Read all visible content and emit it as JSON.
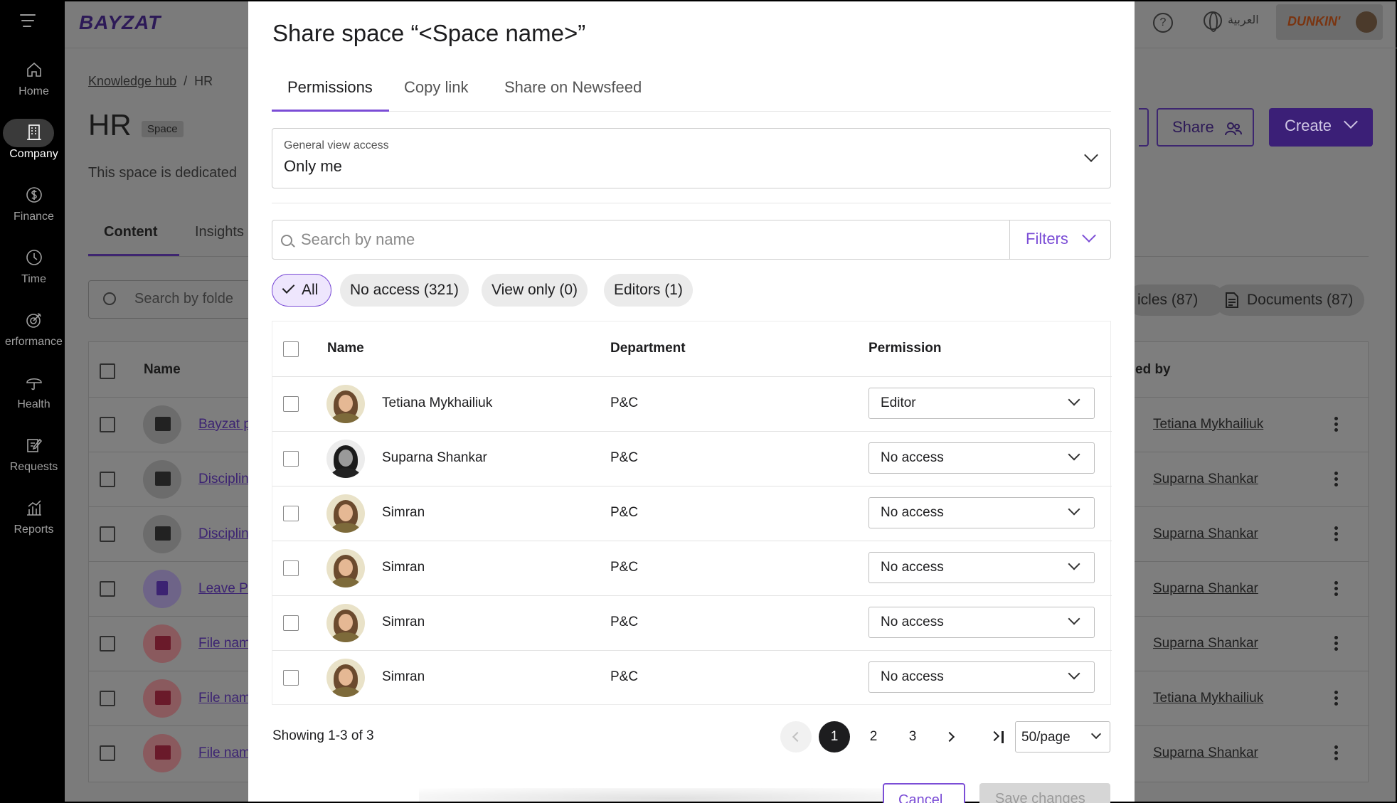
{
  "sidebar": {
    "items": [
      {
        "label": "Home",
        "icon": "home-icon"
      },
      {
        "label": "Company",
        "icon": "building-icon",
        "active": true
      },
      {
        "label": "Finance",
        "icon": "dollar-icon"
      },
      {
        "label": "Time",
        "icon": "clock-icon"
      },
      {
        "label": "erformance",
        "icon": "target-icon"
      },
      {
        "label": "Health",
        "icon": "umbrella-icon"
      },
      {
        "label": "Requests",
        "icon": "edit-icon"
      },
      {
        "label": "Reports",
        "icon": "chart-icon"
      }
    ]
  },
  "topbar": {
    "logo": "BAYZAT",
    "help": "?",
    "language": "العربية",
    "company_brand": "DUNKIN'"
  },
  "page": {
    "breadcrumb": {
      "root": "Knowledge hub",
      "sep": "/",
      "current": "HR"
    },
    "title": "HR",
    "tag": "Space",
    "description": "This space is dedicated",
    "tabs": [
      "Content",
      "Insights"
    ],
    "folder_search_placeholder": "Search by folde",
    "share_label": "Share",
    "create_label": "Create",
    "chips": [
      "icles (87)",
      "Documents (87)"
    ],
    "table_header_name": "Name",
    "table_header_owner": "ed by",
    "rows": [
      {
        "name": "Bayzat p",
        "owner": "Tetiana Mykhailiuk",
        "kind": "folder"
      },
      {
        "name": "Disciplin",
        "owner": "Suparna Shankar",
        "kind": "folder"
      },
      {
        "name": "Disciplin",
        "owner": "Suparna Shankar",
        "kind": "folder"
      },
      {
        "name": "Leave P",
        "owner": "Suparna Shankar",
        "kind": "doc"
      },
      {
        "name": "File nam",
        "owner": "Suparna Shankar",
        "kind": "pdf"
      },
      {
        "name": "File nam",
        "owner": "Tetiana Mykhailiuk",
        "kind": "pdf"
      },
      {
        "name": "File nam",
        "owner": "Suparna Shankar",
        "kind": "pdf"
      }
    ]
  },
  "modal": {
    "title": "Share space “<Space name>”",
    "tabs": [
      "Permissions",
      "Copy link",
      "Share on Newsfeed"
    ],
    "general_access": {
      "label": "General view access",
      "value": "Only me"
    },
    "search_placeholder": "Search by name",
    "filters_label": "Filters",
    "filter_chips": [
      "All",
      "No access (321)",
      "View only (0)",
      "Editors (1)"
    ],
    "columns": {
      "name": "Name",
      "department": "Department",
      "permission": "Permission"
    },
    "people": [
      {
        "name": "Tetiana Mykhailiuk",
        "department": "P&C",
        "permission": "Editor"
      },
      {
        "name": "Suparna Shankar",
        "department": "P&C",
        "permission": "No access"
      },
      {
        "name": "Simran",
        "department": "P&C",
        "permission": "No access"
      },
      {
        "name": "Simran",
        "department": "P&C",
        "permission": "No access"
      },
      {
        "name": "Simran",
        "department": "P&C",
        "permission": "No access"
      },
      {
        "name": "Simran",
        "department": "P&C",
        "permission": "No access"
      }
    ],
    "showing": "Showing 1-3 of 3",
    "pages": [
      "1",
      "2",
      "3"
    ],
    "current_page": "1",
    "per_page": "50/page",
    "cancel_label": "Cancel",
    "save_label": "Save changes"
  },
  "colors": {
    "accent": "#7b4dd6",
    "overlay_dim": "#7b7b7b",
    "sidebar_bg": "#000000"
  }
}
